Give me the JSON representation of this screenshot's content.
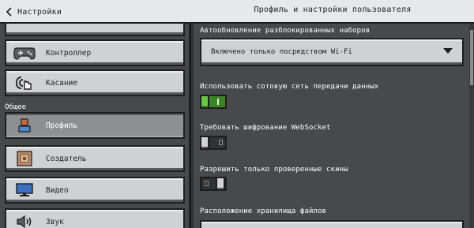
{
  "header": {
    "back_label": "Настройки",
    "title": "Профиль и настройки пользователя"
  },
  "sidebar": {
    "section_general": "Общее",
    "items": [
      {
        "label": "Контроллер",
        "icon": "gamepad-icon"
      },
      {
        "label": "Касание",
        "icon": "touch-icon"
      },
      {
        "label": "Профиль",
        "icon": "profile-icon",
        "selected": true
      },
      {
        "label": "Создатель",
        "icon": "creator-icon"
      },
      {
        "label": "Видео",
        "icon": "monitor-icon"
      },
      {
        "label": "Звук",
        "icon": "speaker-icon"
      }
    ]
  },
  "settings": {
    "auto_update_label": "Автообновление разблокированных наборов",
    "auto_update_value": "Включено только посредством Wi-Fi",
    "cellular_label": "Использовать сотовую сеть передачи данных",
    "cellular_on": true,
    "websocket_label": "Требовать шифрование WebSocket",
    "websocket_on": false,
    "verified_skins_label": "Разрешить только проверенные скины",
    "verified_skins_on": false,
    "storage_label": "Расположение хранилища файлов"
  },
  "colors": {
    "accent_green": "#3c8527",
    "panel_dark": "#48494a",
    "button_light": "#d0d1d4",
    "selected": "#8e8f92"
  }
}
